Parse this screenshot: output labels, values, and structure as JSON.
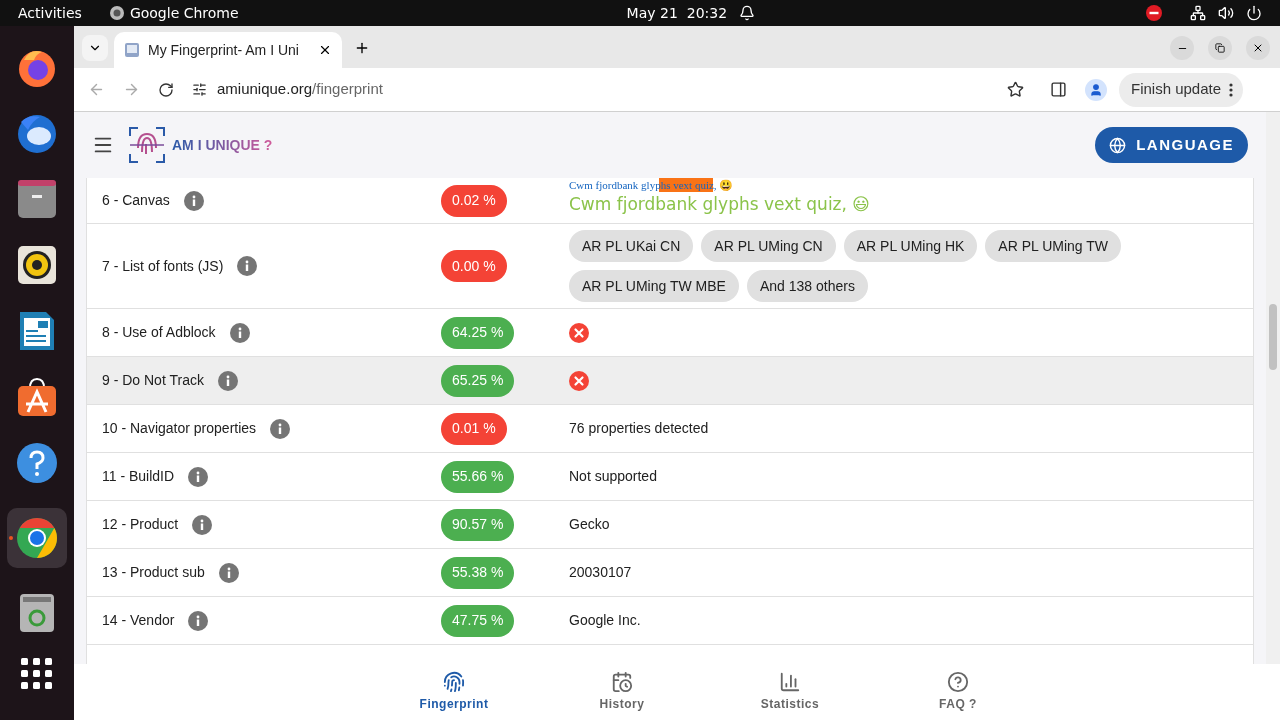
{
  "top_bar": {
    "activities": "Activities",
    "app": "Google Chrome",
    "clock": "May 21  20:32"
  },
  "browser": {
    "tabs": [
      {
        "title": "My Fingerprint- Am I Uni",
        "selected": true
      }
    ],
    "url_host": "amiunique.org",
    "url_path": "/fingerprint",
    "update_button": "Finish update"
  },
  "header": {
    "logo_text": "AM I UNIQUE ?",
    "language_button": "LANGUAGE"
  },
  "rows": [
    {
      "name": "6 - Canvas",
      "percent": "0.02 %",
      "color": "#f44336",
      "highlighted": false,
      "kind": "canvas",
      "small_text": "Cwm fjordbank glyphs vext quiz, 😃",
      "large_text": "Cwm fjordbank glyphs vext quiz, 😃"
    },
    {
      "name": "7 - List of fonts (JS)",
      "percent": "0.00 %",
      "color": "#f44336",
      "highlighted": false,
      "kind": "chips",
      "chips": [
        "AR PL UKai CN",
        "AR PL UMing CN",
        "AR PL UMing HK",
        "AR PL UMing TW",
        "AR PL UMing TW MBE",
        "And 138 others"
      ]
    },
    {
      "name": "8 - Use of Adblock",
      "percent": "64.25 %",
      "color": "#4caf50",
      "highlighted": false,
      "kind": "cross"
    },
    {
      "name": "9 - Do Not Track",
      "percent": "65.25 %",
      "color": "#4caf50",
      "highlighted": true,
      "kind": "cross"
    },
    {
      "name": "10 - Navigator properties",
      "percent": "0.01 %",
      "color": "#f44336",
      "highlighted": false,
      "kind": "text",
      "value": "76 properties detected"
    },
    {
      "name": "11 - BuildID",
      "percent": "55.66 %",
      "color": "#4caf50",
      "highlighted": false,
      "kind": "text",
      "value": "Not supported"
    },
    {
      "name": "12 - Product",
      "percent": "90.57 %",
      "color": "#4caf50",
      "highlighted": false,
      "kind": "text",
      "value": "Gecko"
    },
    {
      "name": "13 - Product sub",
      "percent": "55.38 %",
      "color": "#4caf50",
      "highlighted": false,
      "kind": "text",
      "value": "20030107"
    },
    {
      "name": "14 - Vendor",
      "percent": "47.75 %",
      "color": "#4caf50",
      "highlighted": false,
      "kind": "text",
      "value": "Google Inc."
    }
  ],
  "bottom_nav": [
    {
      "label": "Fingerprint",
      "selected": true,
      "kind": "fingerprint"
    },
    {
      "label": "History",
      "selected": false,
      "kind": "history"
    },
    {
      "label": "Statistics",
      "selected": false,
      "kind": "statistics"
    },
    {
      "label": "FAQ ?",
      "selected": false,
      "kind": "faq"
    }
  ]
}
